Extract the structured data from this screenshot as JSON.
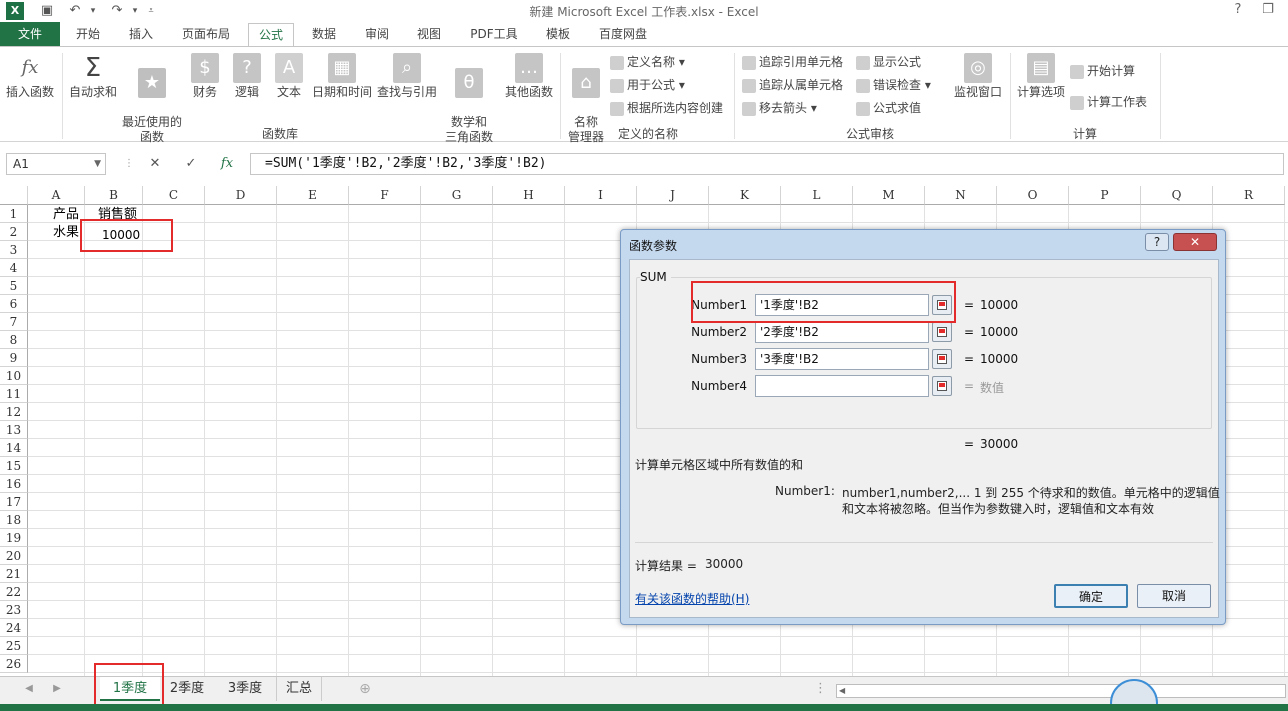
{
  "window": {
    "title": "新建 Microsoft Excel 工作表.xlsx - Excel",
    "help_icon": "?",
    "restore_icon": "❐"
  },
  "quick_access": {
    "logo": "X",
    "save_icon": "save-icon",
    "undo_icon": "undo-icon",
    "redo_icon": "redo-icon",
    "customize_icon": "more-icon"
  },
  "tabs": [
    "文件",
    "开始",
    "插入",
    "页面布局",
    "公式",
    "数据",
    "审阅",
    "视图",
    "PDF工具",
    "模板",
    "百度网盘"
  ],
  "active_tab": "公式",
  "ribbon": {
    "insert_function": "插入函数",
    "autosum": "自动求和",
    "recent": "最近使用的\n函数",
    "financial": "财务",
    "logical": "逻辑",
    "text": "文本",
    "datetime": "日期和时间",
    "lookup": "查找与引用",
    "math": "数学和\n三角函数",
    "more": "其他函数",
    "group_library": "函数库",
    "name_manager": "名称\n管理器",
    "define_name": "定义名称",
    "use_in_formula": "用于公式",
    "create_from_selection": "根据所选内容创建",
    "group_names": "定义的名称",
    "trace_precedents": "追踪引用单元格",
    "trace_dependents": "追踪从属单元格",
    "remove_arrows": "移去箭头",
    "show_formulas": "显示公式",
    "error_checking": "错误检查",
    "evaluate": "公式求值",
    "watch_window": "监视窗口",
    "group_audit": "公式审核",
    "calc_options": "计算选项",
    "calc_now": "开始计算",
    "calc_sheet": "计算工作表",
    "group_calc": "计算"
  },
  "formula_bar": {
    "name_box": "A1",
    "cancel_icon": "✕",
    "enter_icon": "✓",
    "fx": "fx",
    "formula": "=SUM('1季度'!B2,'2季度'!B2,'3季度'!B2)"
  },
  "columns": [
    "A",
    "B",
    "C",
    "D",
    "E",
    "F",
    "G",
    "H",
    "I",
    "J",
    "K",
    "L",
    "M",
    "N",
    "O",
    "P",
    "Q",
    "R"
  ],
  "rows": [
    "1",
    "2",
    "3",
    "4",
    "5",
    "6",
    "7",
    "8",
    "9",
    "10",
    "11",
    "12",
    "13",
    "14",
    "15",
    "16",
    "17",
    "18",
    "19",
    "20",
    "21",
    "22",
    "23",
    "24",
    "25",
    "26"
  ],
  "cells": {
    "A1": "产品",
    "B1": "销售额",
    "A2": "水果",
    "B2": "10000"
  },
  "sheets": [
    "1季度",
    "2季度",
    "3季度",
    "汇总"
  ],
  "active_sheet": "1季度",
  "dialog": {
    "title": "函数参数",
    "help_btn": "?",
    "close_btn": "✕",
    "function_name": "SUM",
    "args": [
      {
        "label": "Number1",
        "value": "'1季度'!B2",
        "result": "10000"
      },
      {
        "label": "Number2",
        "value": "'2季度'!B2",
        "result": "10000"
      },
      {
        "label": "Number3",
        "value": "'3季度'!B2",
        "result": "10000"
      },
      {
        "label": "Number4",
        "value": "",
        "result": "数值"
      }
    ],
    "total": "30000",
    "description": "计算单元格区域中所有数值的和",
    "arg_desc_label": "Number1:",
    "arg_desc_line1": "number1,number2,...  1 到 255 个待求和的数值。单元格中的逻辑值",
    "arg_desc_line2": "和文本将被忽略。但当作为参数键入时，逻辑值和文本有效",
    "result_label": "计算结果 =",
    "result_value": "30000",
    "help_link": "有关该函数的帮助(H)",
    "ok": "确定",
    "cancel": "取消"
  }
}
